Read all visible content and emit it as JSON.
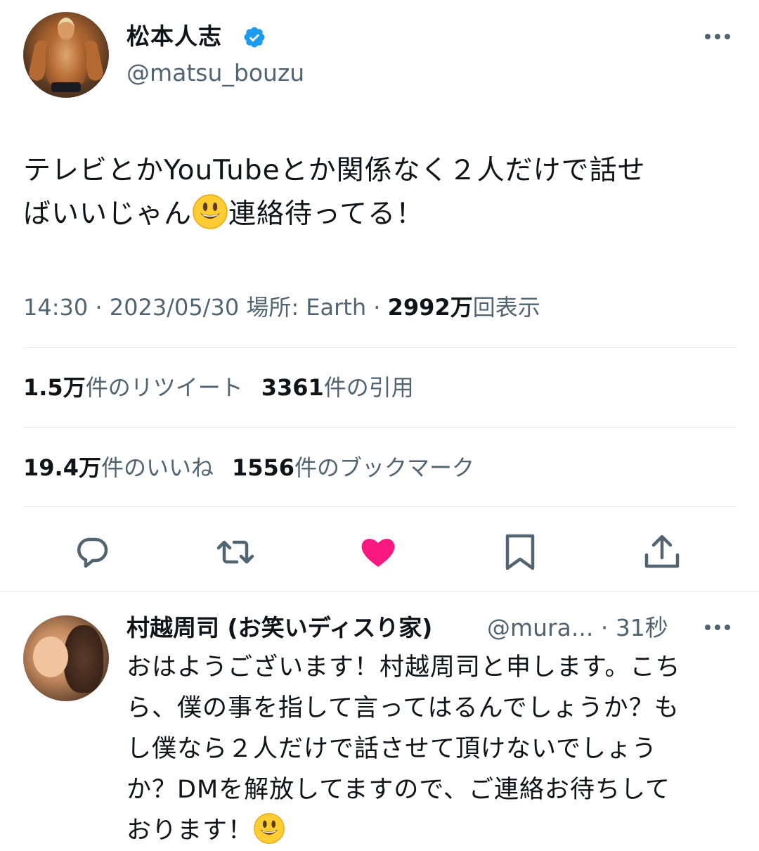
{
  "tweet": {
    "display_name": "松本人志",
    "handle": "@matsu_bouzu",
    "text_line1": "テレビとかYouTubeとか関係なく２人だけで話せ",
    "text_line2_a": "ばいいじゃん",
    "text_line2_b": "連絡待ってる！",
    "emoji_icon": "smiling-face-emoji",
    "time": "14:30",
    "date": "2023/05/30",
    "location_label": "場所: Earth",
    "views_value": "2992万",
    "views_label": "回表示",
    "stats": {
      "retweets_value": "1.5万",
      "retweets_label": "件のリツイート",
      "quotes_value": "3361",
      "quotes_label": "件の引用",
      "likes_value": "19.4万",
      "likes_label": "件のいいね",
      "bookmarks_value": "1556",
      "bookmarks_label": "件のブックマーク"
    },
    "actions": [
      "reply-icon",
      "retweet-icon",
      "like-icon",
      "bookmark-icon",
      "share-icon"
    ],
    "liked": true
  },
  "reply": {
    "display_name": "村越周司 (お笑いディスり家)",
    "handle": "@mura...",
    "time": "31秒",
    "text_l1": "おはようございます！村越周司と申します。こち",
    "text_l2": "ら、僕の事を指して言ってはるんでしょうか？も",
    "text_l3": "し僕なら２人だけで話させて頂けないでしょう",
    "text_l4": "か？DMを解放してますので、ご連絡お待ちして",
    "text_l5": "おります！"
  },
  "colors": {
    "text": "#0f1419",
    "secondary": "#536471",
    "verified": "#1d9bf0",
    "like": "#f91880",
    "divider": "#e2e6ea"
  }
}
